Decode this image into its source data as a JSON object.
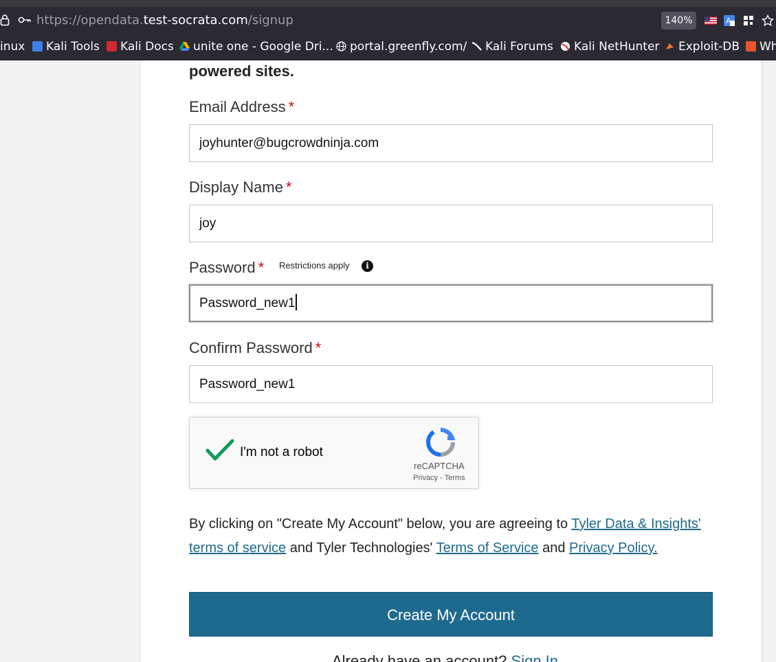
{
  "browser": {
    "url_prefix": "https://opendata.",
    "url_domain": "test-socrata.com",
    "url_path": "/signup",
    "zoom": "140%"
  },
  "bookmarks": [
    {
      "label": "inux",
      "icon": "kali-icon",
      "color": "#00000000"
    },
    {
      "label": "Kali Tools",
      "icon": "kali-tools-icon",
      "color": "#3f7ee8"
    },
    {
      "label": "Kali Docs",
      "icon": "kali-docs-icon",
      "color": "#d02a2a"
    },
    {
      "label": "unite one - Google Dri...",
      "icon": "google-drive-icon",
      "color": "#f4b400"
    },
    {
      "label": "portal.greenfly.com/",
      "icon": "globe-icon",
      "color": "#00000000"
    },
    {
      "label": "Kali Forums",
      "icon": "kali-forums-icon",
      "color": "#00000000"
    },
    {
      "label": "Kali NetHunter",
      "icon": "kali-nethunter-icon",
      "color": "#d33"
    },
    {
      "label": "Exploit-DB",
      "icon": "exploit-db-icon",
      "color": "#e8752a"
    },
    {
      "label": "Wh",
      "icon": "bookmark-icon",
      "color": "#e8552a"
    }
  ],
  "form": {
    "lead_text": "powered sites.",
    "email_label": "Email Address",
    "email_value": "joyhunter@bugcrowdninja.com",
    "display_name_label": "Display Name",
    "display_name_value": "joy",
    "password_label": "Password",
    "password_hint": "Restrictions apply",
    "password_value": "Password_new1",
    "confirm_label": "Confirm Password",
    "confirm_value": "Password_new1",
    "required_mark": "*"
  },
  "captcha": {
    "label": "I'm not a robot",
    "brand": "reCAPTCHA",
    "privacy": "Privacy",
    "separator": "-",
    "terms": "Terms",
    "checked": true
  },
  "terms": {
    "text1": "By clicking on \"Create My Account\" below, you are agreeing to ",
    "link1": "Tyler Data & Insights' terms of service",
    "text2": " and Tyler Technologies' ",
    "link2": "Terms of Service",
    "text3": " and ",
    "link3": "Privacy Policy."
  },
  "submit_label": "Create My Account",
  "signin": {
    "prompt": "Already have an account? ",
    "link": "Sign In"
  }
}
